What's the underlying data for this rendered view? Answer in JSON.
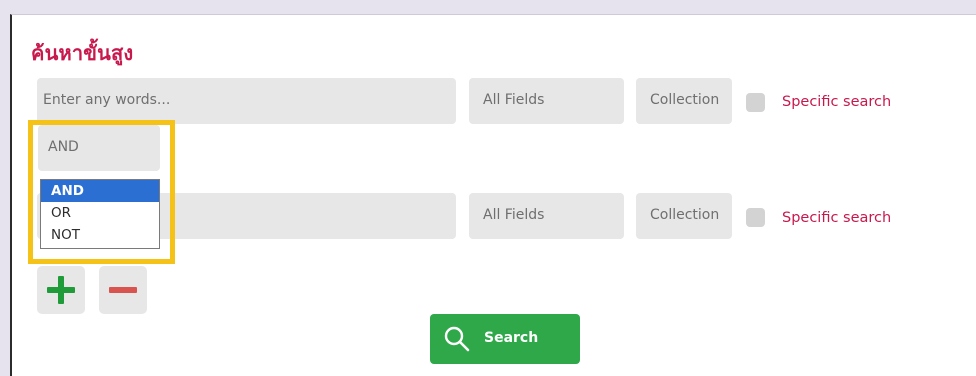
{
  "header": {
    "title": "ค้นหาขั้นสูง"
  },
  "rows": [
    {
      "input": {
        "value": "",
        "placeholder": "Enter any words..."
      },
      "field": "All Fields",
      "scope": "Collection",
      "specific": "Specific search"
    },
    {
      "input": {
        "value": "",
        "placeholder": ""
      },
      "field": "All Fields",
      "scope": "Collection",
      "specific": "Specific search"
    }
  ],
  "operator": {
    "selected": "AND",
    "options": [
      "AND",
      "OR",
      "NOT"
    ],
    "highlighted": "AND"
  },
  "actions": {
    "add_icon": "plus-icon",
    "remove_icon": "minus-icon"
  },
  "search_button": {
    "label": "Search",
    "icon": "search-icon"
  },
  "colors": {
    "accent": "#c8194d",
    "highlight": "#f5c318",
    "primary": "#2fa84a",
    "selection": "#2b6fd3"
  }
}
